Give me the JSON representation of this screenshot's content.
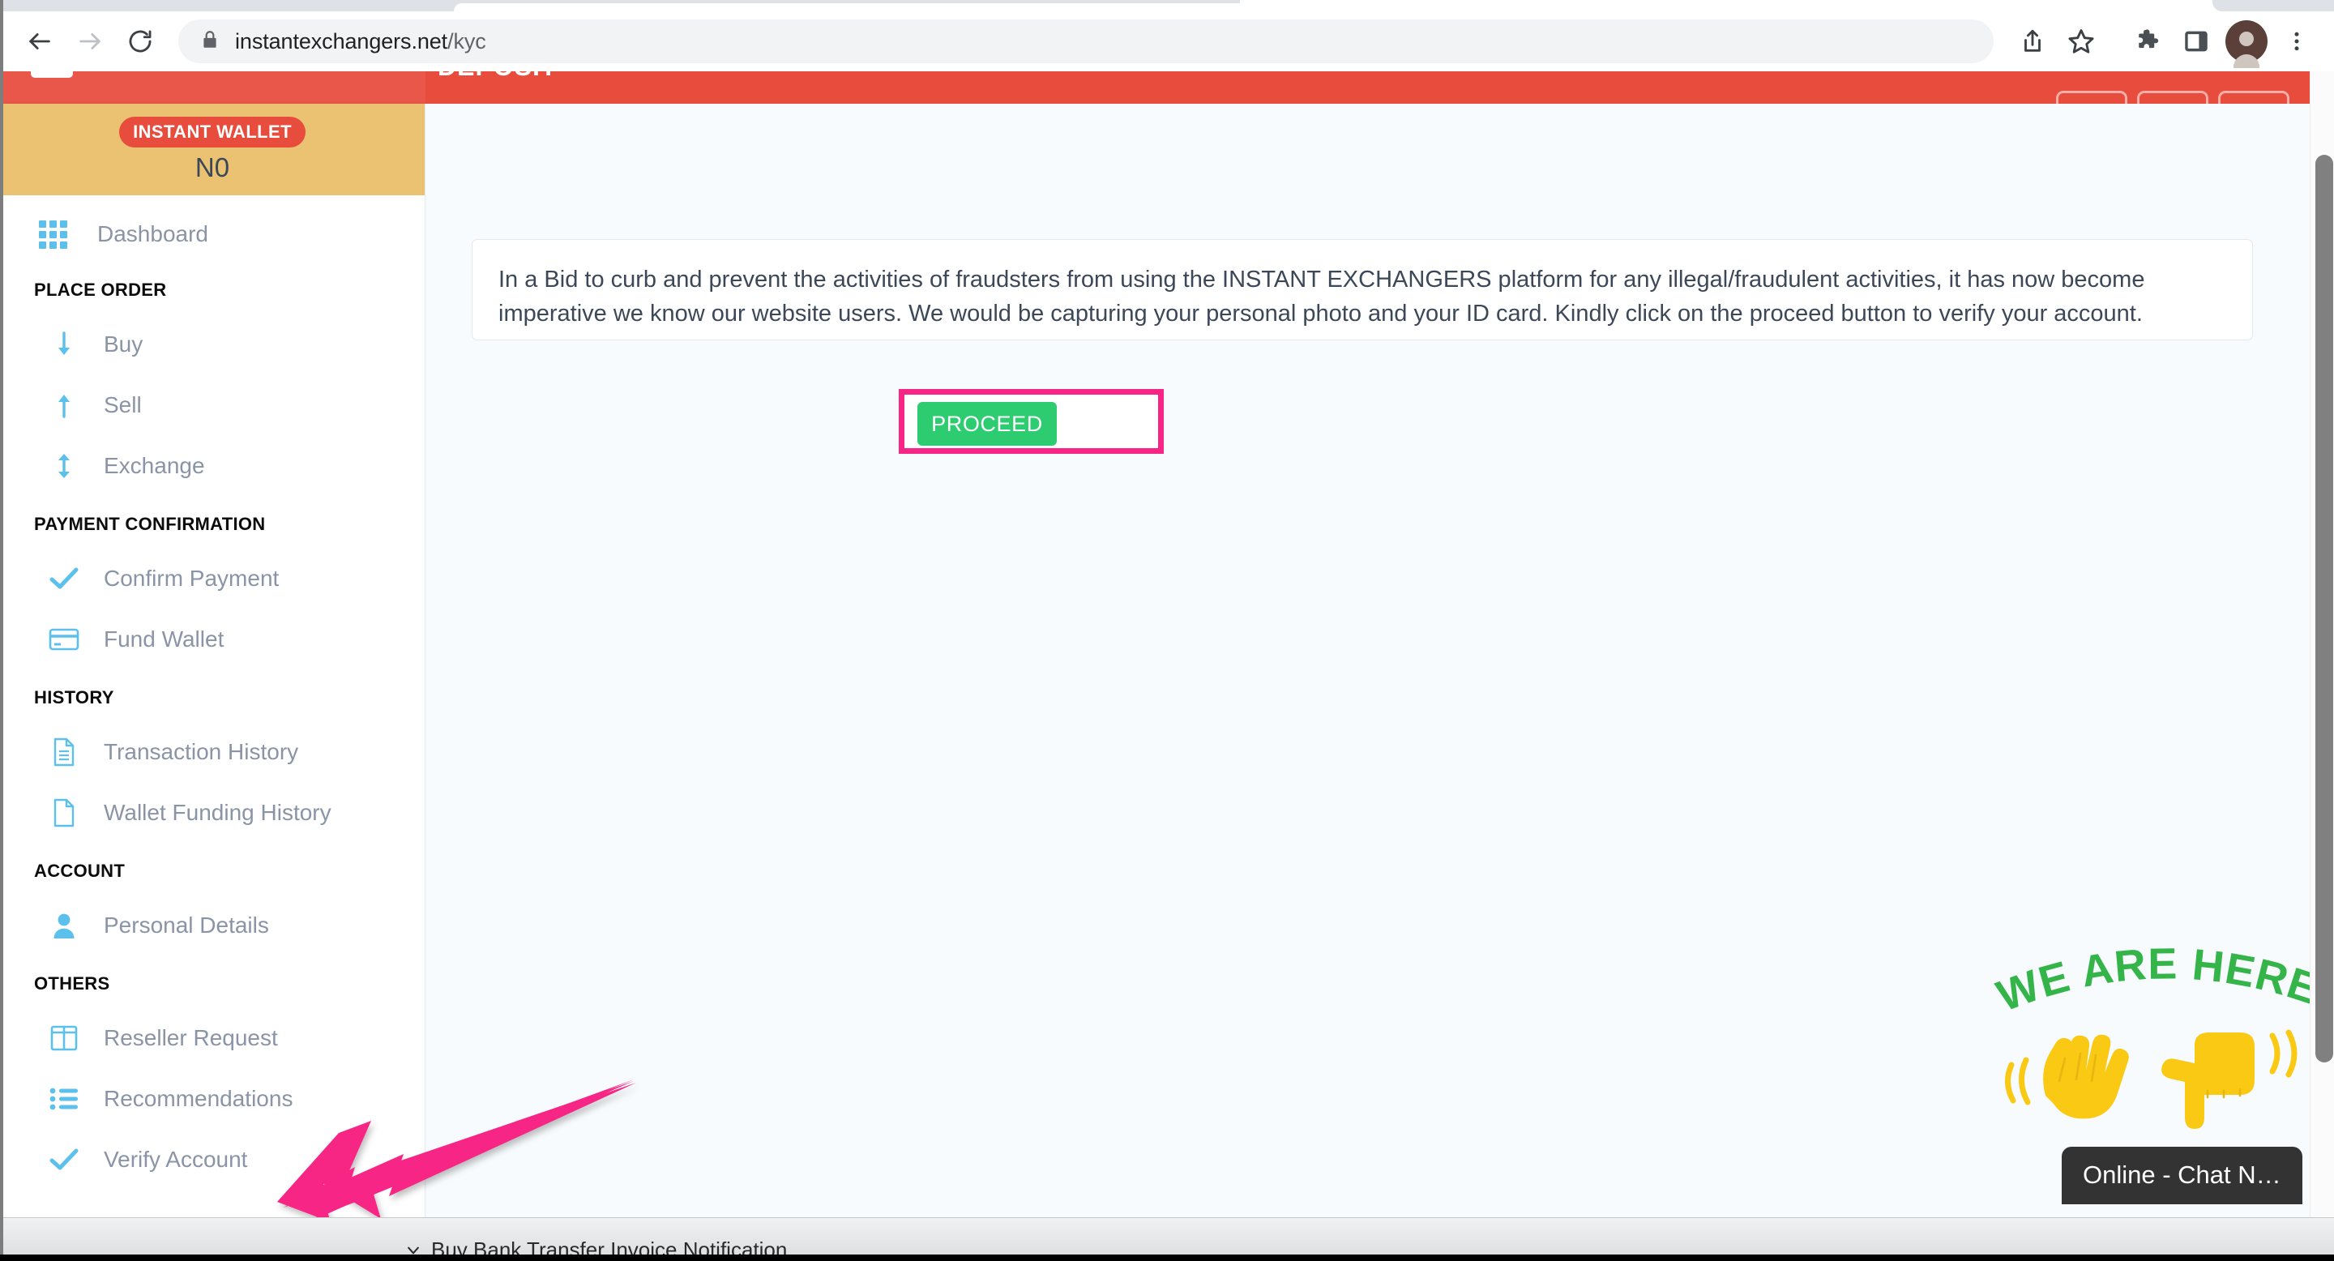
{
  "browser": {
    "url_host": "instantexchangers.net",
    "url_path": "/kyc",
    "nav": {
      "back_label": "Back",
      "forward_label": "Forward",
      "reload_label": "Reload"
    },
    "toolbar_icons": [
      "share-icon",
      "bookmark-star-icon",
      "extensions-puzzle-icon",
      "side-panel-icon",
      "profile-avatar-icon",
      "more-vertical-icon"
    ],
    "lock_icon": "lock-icon"
  },
  "app_header": {
    "title": "DEPOSIT",
    "menu_icon": "hamburger-menu-icon",
    "pills": [
      "",
      "",
      ""
    ]
  },
  "sidebar": {
    "wallet": {
      "badge": "INSTANT WALLET",
      "balance": "N0"
    },
    "dashboard": {
      "label": "Dashboard",
      "icon": "grid-icon"
    },
    "groups": [
      {
        "title": "PLACE ORDER",
        "items": [
          {
            "label": "Buy",
            "icon": "arrow-down-icon"
          },
          {
            "label": "Sell",
            "icon": "arrow-up-icon"
          },
          {
            "label": "Exchange",
            "icon": "arrows-up-down-icon"
          }
        ]
      },
      {
        "title": "PAYMENT CONFIRMATION",
        "items": [
          {
            "label": "Confirm Payment",
            "icon": "check-icon"
          },
          {
            "label": "Fund Wallet",
            "icon": "credit-card-icon"
          }
        ]
      },
      {
        "title": "HISTORY",
        "items": [
          {
            "label": "Transaction History",
            "icon": "document-lines-icon"
          },
          {
            "label": "Wallet Funding History",
            "icon": "document-blank-icon"
          }
        ]
      },
      {
        "title": "ACCOUNT",
        "items": [
          {
            "label": "Personal Details",
            "icon": "person-icon"
          }
        ]
      },
      {
        "title": "OTHERS",
        "items": [
          {
            "label": "Reseller Request",
            "icon": "columns-icon"
          },
          {
            "label": "Recommendations",
            "icon": "list-bullets-icon"
          },
          {
            "label": "Verify Account",
            "icon": "check-icon"
          }
        ]
      }
    ]
  },
  "main": {
    "kyc_notice": "In a Bid to curb and prevent the activities of fraudsters from using the INSTANT EXCHANGERS platform for any illegal/fraudulent activities, it has now become imperative we know our website users. We would be capturing your personal photo and your ID card. Kindly click on the proceed button to verify your account.",
    "proceed_label": "PROCEED"
  },
  "annotations": {
    "arrow_color": "#f72585",
    "highlight_color": "#f72585",
    "arrow_target": "Verify Account",
    "highlight_target": "PROCEED"
  },
  "chat_widget": {
    "headline": "WE ARE HERE!",
    "status_label": "Online - Chat N…",
    "hand_icons": [
      "waving-hand-icon",
      "pointing-down-hand-icon"
    ],
    "headline_color": "#35b44a",
    "hand_color": "#f6c game"
  },
  "download_bar": {
    "item_label": "Buy Bank Transfer Invoice Notification",
    "item_icon": "chevron-down-icon"
  },
  "colors": {
    "header_red": "#e74c3c",
    "wallet_gold": "#eac272",
    "proceed_green": "#2ecc71",
    "icon_blue": "#5bc0eb",
    "page_bg": "#f7fbfd"
  }
}
